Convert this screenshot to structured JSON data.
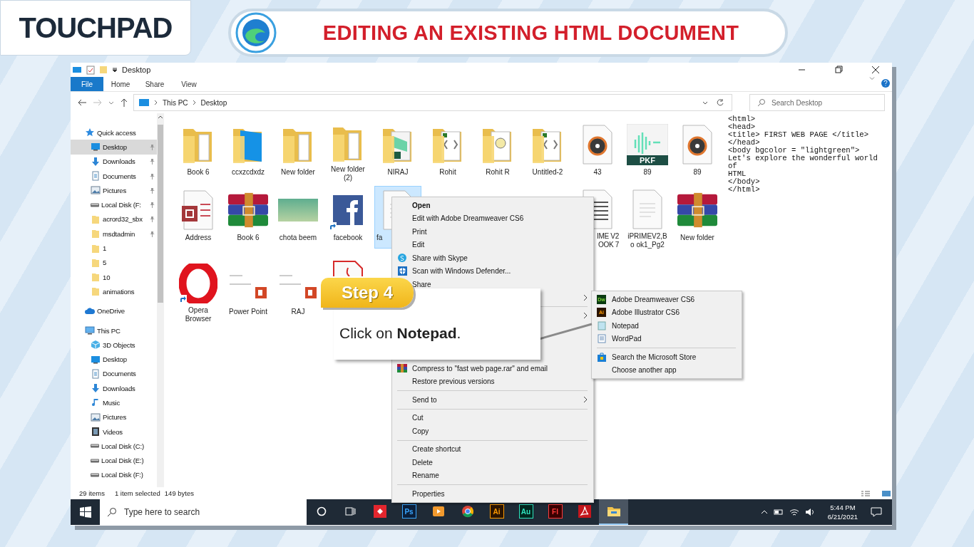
{
  "header": {
    "logo": "TOUCHPAD",
    "title": "EDITING AN EXISTING HTML DOCUMENT"
  },
  "window": {
    "title": "Desktop"
  },
  "ribbon": {
    "tabs": [
      {
        "label": "File",
        "selected": true
      },
      {
        "label": "Home",
        "selected": false
      },
      {
        "label": "Share",
        "selected": false
      },
      {
        "label": "View",
        "selected": false
      }
    ]
  },
  "address": {
    "crumbs": [
      "This PC",
      "Desktop"
    ],
    "search_placeholder": "Search Desktop"
  },
  "sidebar": {
    "items": [
      {
        "label": "Quick access",
        "kind": "star",
        "selected": false,
        "children": [
          {
            "label": "Desktop",
            "kind": "desktop",
            "pinned": true,
            "selected": true
          },
          {
            "label": "Downloads",
            "kind": "download",
            "pinned": true,
            "selected": false
          },
          {
            "label": "Documents",
            "kind": "document",
            "pinned": true,
            "selected": false
          },
          {
            "label": "Pictures",
            "kind": "pictures",
            "pinned": true,
            "selected": false
          },
          {
            "label": "Local Disk (F:",
            "kind": "drive",
            "pinned": true,
            "selected": false
          },
          {
            "label": "acrord32_sbx",
            "kind": "folder",
            "pinned": true,
            "selected": false
          },
          {
            "label": "msdtadmin",
            "kind": "folder",
            "pinned": true,
            "selected": false
          },
          {
            "label": "1",
            "kind": "folder",
            "pinned": false,
            "selected": false
          },
          {
            "label": "5",
            "kind": "folder",
            "pinned": false,
            "selected": false
          },
          {
            "label": "10",
            "kind": "folder",
            "pinned": false,
            "selected": false
          },
          {
            "label": "animations",
            "kind": "folder",
            "pinned": false,
            "selected": false
          }
        ]
      },
      {
        "label": "OneDrive",
        "kind": "cloud",
        "selected": false
      },
      {
        "label": "This PC",
        "kind": "pc",
        "selected": false,
        "children": [
          {
            "label": "3D Objects",
            "kind": "cube",
            "selected": false
          },
          {
            "label": "Desktop",
            "kind": "desktop",
            "selected": false
          },
          {
            "label": "Documents",
            "kind": "document",
            "selected": false
          },
          {
            "label": "Downloads",
            "kind": "download",
            "selected": false
          },
          {
            "label": "Music",
            "kind": "music",
            "selected": false
          },
          {
            "label": "Pictures",
            "kind": "pictures",
            "selected": false
          },
          {
            "label": "Videos",
            "kind": "video",
            "selected": false
          },
          {
            "label": "Local Disk (C:)",
            "kind": "drive",
            "selected": false
          },
          {
            "label": "Local Disk (E:)",
            "kind": "drive",
            "selected": false
          },
          {
            "label": "Local Disk (F:)",
            "kind": "drive",
            "selected": false
          }
        ]
      }
    ]
  },
  "files": [
    {
      "items": [
        {
          "kind": "folder",
          "label": "Book 6",
          "selected": false
        },
        {
          "kind": "folder-blue",
          "label": "ccxzcdxdz",
          "selected": false
        },
        {
          "kind": "folder",
          "label": "New folder",
          "selected": false
        },
        {
          "kind": "folder",
          "label": "New folder (2)",
          "selected": false
        },
        {
          "kind": "folder-doc",
          "label": "NIRAJ",
          "selected": false
        },
        {
          "kind": "folder-code",
          "label": "Rohit",
          "selected": false
        },
        {
          "kind": "folder-face",
          "label": "Rohit R",
          "selected": false
        },
        {
          "kind": "folder-code",
          "label": "Untitled-2",
          "selected": false
        },
        {
          "kind": "disc",
          "label": "43",
          "selected": false
        },
        {
          "kind": "pkf",
          "icon_text": "PKF",
          "label": "89",
          "selected": false
        },
        {
          "kind": "disc",
          "label": "89",
          "selected": false
        }
      ]
    },
    {
      "items": [
        {
          "kind": "access",
          "label": "Address",
          "selected": false
        },
        {
          "kind": "rar",
          "label": "Book 6",
          "selected": false
        },
        {
          "kind": "photo",
          "label": "chota beem",
          "selected": false
        },
        {
          "kind": "facebook",
          "label": "facebook",
          "shortcut": true,
          "selected": false
        },
        {
          "kind": "page-partial",
          "label": "fa",
          "selected": true
        },
        {
          "kind": "covered"
        },
        {
          "kind": "covered"
        },
        {
          "kind": "covered"
        },
        {
          "kind": "doc-partial",
          "label": "IME V2 OOK 7",
          "selected": false
        },
        {
          "kind": "page",
          "label": "iPRIMEV2,Bo ok1_Pg2",
          "selected": false
        },
        {
          "kind": "rar",
          "label": "New folder",
          "selected": false
        }
      ]
    },
    {
      "items": [
        {
          "kind": "opera",
          "label": "Opera Browser",
          "shortcut": true,
          "selected": false
        },
        {
          "kind": "ppt",
          "label": "Power Point",
          "selected": false
        },
        {
          "kind": "ppt",
          "label": "RAJ",
          "selected": false
        },
        {
          "kind": "pdf",
          "selected": false
        }
      ]
    }
  ],
  "preview": {
    "lines": [
      "<html>",
      "<head>",
      "<title> FIRST WEB PAGE </title>",
      "</head>",
      "<body bgcolor = \"lightgreen\">",
      "Let's explore the wonderful world",
      "of",
      "HTML",
      "</body>",
      "</html>"
    ]
  },
  "status": {
    "count": "29 items",
    "selection": "1 item selected",
    "size": "149 bytes"
  },
  "context_menu": [
    {
      "kind": "default",
      "label": "Open"
    },
    {
      "kind": "item",
      "label": "Edit with Adobe Dreamweaver CS6"
    },
    {
      "kind": "item",
      "label": "Print"
    },
    {
      "kind": "item",
      "label": "Edit"
    },
    {
      "kind": "skype",
      "label": "Share with Skype"
    },
    {
      "kind": "defender",
      "label": "Scan with Windows Defender..."
    },
    {
      "kind": "item",
      "label": "Share"
    },
    {
      "kind": "covered",
      "submenu": true
    },
    {
      "kind": "separator"
    },
    {
      "kind": "covered",
      "submenu": true
    },
    {
      "kind": "covered"
    },
    {
      "kind": "covered"
    },
    {
      "kind": "covered"
    },
    {
      "kind": "archive",
      "label": "Compress to \"fast web page.rar\" and email"
    },
    {
      "kind": "item",
      "label": "Restore previous versions"
    },
    {
      "kind": "separator"
    },
    {
      "kind": "item",
      "label": "Send to",
      "submenu": true
    },
    {
      "kind": "separator"
    },
    {
      "kind": "item",
      "label": "Cut"
    },
    {
      "kind": "item",
      "label": "Copy"
    },
    {
      "kind": "separator"
    },
    {
      "kind": "item",
      "label": "Create shortcut"
    },
    {
      "kind": "item",
      "label": "Delete"
    },
    {
      "kind": "item",
      "label": "Rename"
    },
    {
      "kind": "separator"
    },
    {
      "kind": "item",
      "label": "Properties"
    }
  ],
  "open_with": [
    {
      "kind": "dw",
      "icon_text": "Dw",
      "label": "Adobe Dreamweaver CS6"
    },
    {
      "kind": "ai",
      "icon_text": "Ai",
      "label": "Adobe Illustrator CS6"
    },
    {
      "kind": "notepad",
      "label": "Notepad"
    },
    {
      "kind": "wordpad",
      "label": "WordPad"
    },
    {
      "kind": "separator"
    },
    {
      "kind": "store",
      "label": "Search the Microsoft Store"
    },
    {
      "kind": "item",
      "label": "Choose another app"
    }
  ],
  "callout": {
    "step": "Step 4",
    "text": "Click on **Notepad**."
  },
  "taskbar": {
    "search_placeholder": "Type here to search",
    "apps": [
      {
        "kind": "cortana",
        "selected": false
      },
      {
        "kind": "taskview",
        "selected": false
      },
      {
        "kind": "red-app",
        "selected": false
      },
      {
        "kind": "ps",
        "text": "Ps",
        "selected": false
      },
      {
        "kind": "media",
        "selected": false
      },
      {
        "kind": "chrome",
        "selected": false
      },
      {
        "kind": "ai",
        "text": "Ai",
        "selected": false
      },
      {
        "kind": "au",
        "text": "Au",
        "selected": false
      },
      {
        "kind": "fl",
        "text": "Fl",
        "selected": false
      },
      {
        "kind": "acrobat",
        "selected": false
      },
      {
        "kind": "explorer",
        "selected": true
      }
    ],
    "time": "5:44 PM",
    "date": "6/21/2021"
  }
}
